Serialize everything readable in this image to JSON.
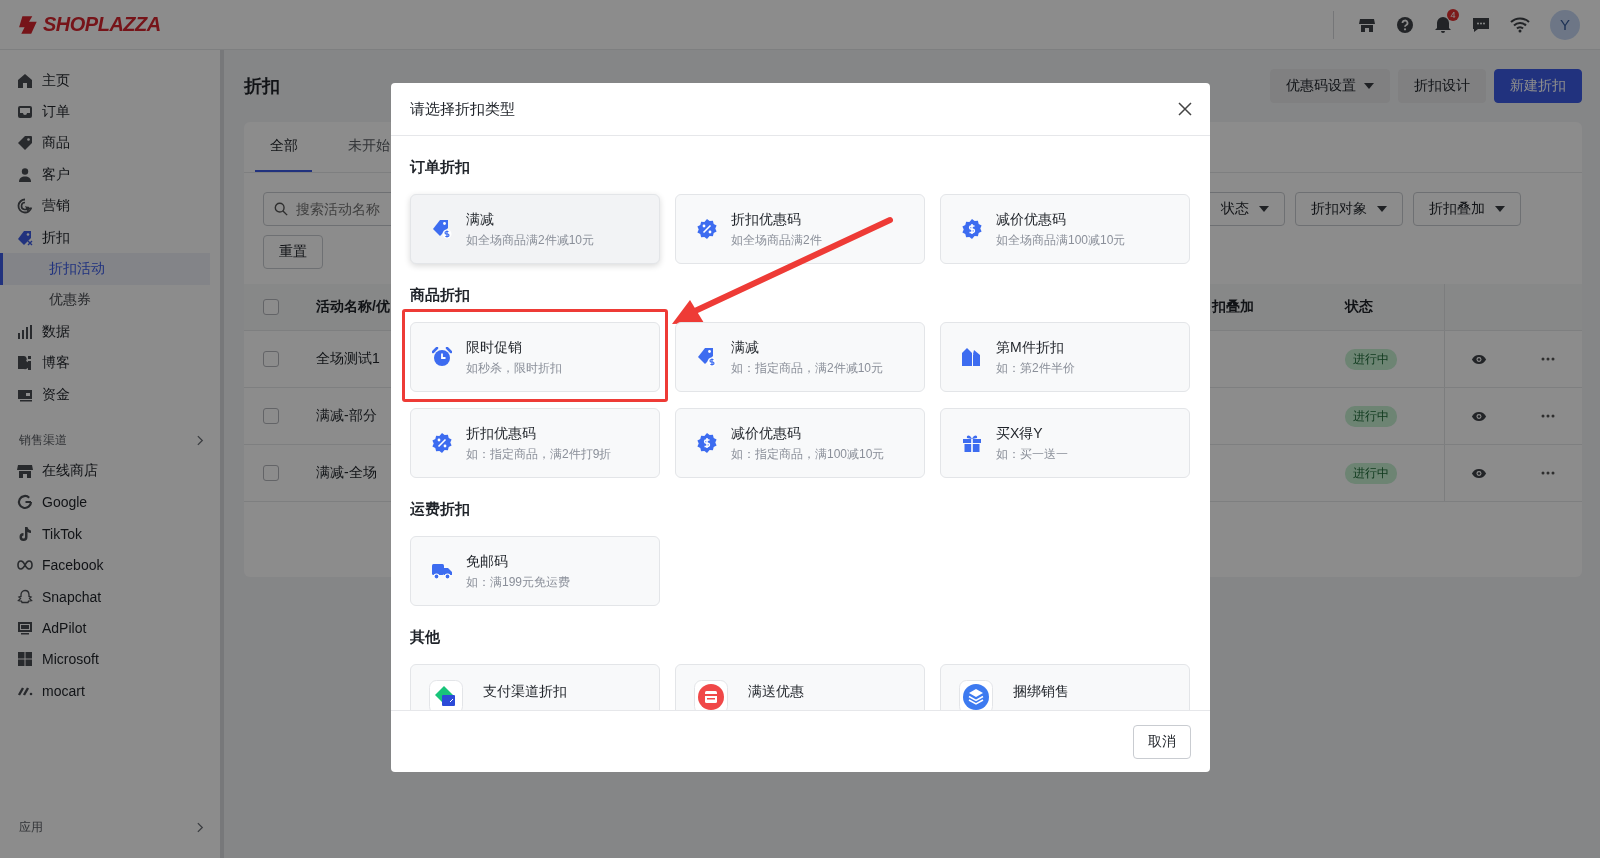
{
  "topbar": {
    "logo": "SHOPLAZZA",
    "notification_count": "4",
    "avatar": "Y"
  },
  "sidebar": {
    "items": [
      {
        "label": "主页",
        "selected": false
      },
      {
        "label": "订单",
        "selected": false
      },
      {
        "label": "商品",
        "selected": false
      },
      {
        "label": "客户",
        "selected": false
      },
      {
        "label": "营销",
        "selected": false
      },
      {
        "label": "折扣",
        "selected": false,
        "children": [
          {
            "label": "折扣活动",
            "selected": true
          },
          {
            "label": "优惠券",
            "selected": false
          }
        ]
      },
      {
        "label": "数据",
        "selected": false
      },
      {
        "label": "博客",
        "selected": false
      },
      {
        "label": "资金",
        "selected": false
      }
    ],
    "channels_header": "销售渠道",
    "channels": [
      {
        "label": "在线商店"
      },
      {
        "label": "Google"
      },
      {
        "label": "TikTok"
      },
      {
        "label": "Facebook"
      },
      {
        "label": "Snapchat"
      },
      {
        "label": "AdPilot"
      },
      {
        "label": "Microsoft"
      },
      {
        "label": "mocart"
      }
    ],
    "apps_header": "应用"
  },
  "page": {
    "title": "折扣",
    "actions": [
      {
        "label": "优惠码设置",
        "kind": "dropdown"
      },
      {
        "label": "折扣设计",
        "kind": "default"
      },
      {
        "label": "新建折扣",
        "kind": "primary"
      }
    ],
    "tabs": [
      {
        "label": "全部",
        "selected": true
      },
      {
        "label": "未开始",
        "selected": false
      }
    ],
    "search": {
      "placeholder": "搜索活动名称"
    },
    "filters": [
      "状态",
      "折扣对象",
      "折扣叠加"
    ],
    "reset": "重置",
    "table": {
      "header_checked": false,
      "columns": [
        "活动名称/优",
        "扣叠加",
        "状态"
      ],
      "rows": [
        {
          "checked": false,
          "name": "全场测试1",
          "status": "进行中"
        },
        {
          "checked": false,
          "name": "满减-部分",
          "status": "进行中"
        },
        {
          "checked": false,
          "name": "满减-全场",
          "status": "进行中"
        }
      ]
    }
  },
  "dialog": {
    "title": "请选择折扣类型",
    "cancel": "取消",
    "sections": [
      {
        "title": "订单折扣",
        "cards": [
          {
            "kind": "tag",
            "title": "满减",
            "description": "如全场商品满2件减10元",
            "hovered": true,
            "annotated": false
          },
          {
            "kind": "percent",
            "title": "折扣优惠码",
            "description": "如全场商品满2件",
            "hovered": false,
            "annotated": false
          },
          {
            "kind": "dollar",
            "title": "减价优惠码",
            "description": "如全场商品满100减10元",
            "hovered": false,
            "annotated": false
          }
        ]
      },
      {
        "title": "商品折扣",
        "cards": [
          {
            "kind": "alarm",
            "title": "限时促销",
            "description": "如秒杀，限时折扣",
            "hovered": false,
            "annotated": true
          },
          {
            "kind": "tag",
            "title": "满减",
            "description": "如：指定商品，满2件减10元",
            "hovered": false,
            "annotated": false
          },
          {
            "kind": "tags",
            "title": "第M件折扣",
            "description": "如：第2件半价",
            "hovered": false,
            "annotated": false
          },
          {
            "kind": "percent",
            "title": "折扣优惠码",
            "description": "如：指定商品，满2件打9折",
            "hovered": false,
            "annotated": false
          },
          {
            "kind": "dollar",
            "title": "减价优惠码",
            "description": "如：指定商品，满100减10元",
            "hovered": false,
            "annotated": false
          },
          {
            "kind": "gift",
            "title": "买X得Y",
            "description": "如：买一送一",
            "hovered": false,
            "annotated": false
          }
        ]
      },
      {
        "title": "运费折扣",
        "cards": [
          {
            "kind": "truck",
            "title": "免邮码",
            "description": "如：满199元免运费",
            "hovered": false,
            "annotated": false
          }
        ]
      },
      {
        "title": "其他",
        "cards": [
          {
            "kind": "payment",
            "title": "支付渠道折扣",
            "hovered": false,
            "annotated": false
          },
          {
            "kind": "giveaway",
            "title": "满送优惠",
            "hovered": false,
            "annotated": false
          },
          {
            "kind": "bundle",
            "title": "捆绑销售",
            "hovered": false,
            "annotated": false
          }
        ]
      }
    ]
  }
}
